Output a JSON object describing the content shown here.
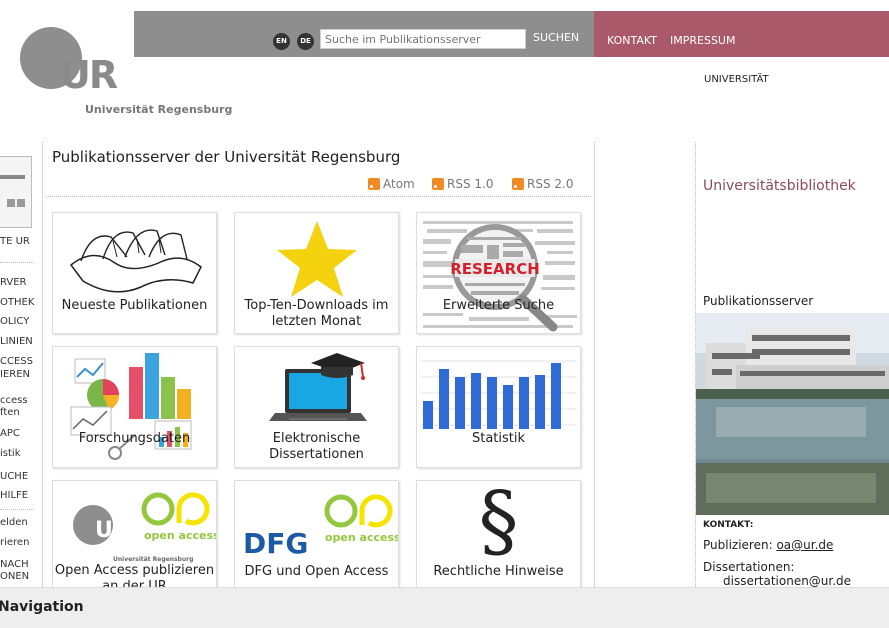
{
  "header": {
    "logo_letters": "UR",
    "logo_text": "Universität Regensburg",
    "lang_en": "EN",
    "lang_de": "DE",
    "search_placeholder": "Suche im Publikationsserver",
    "search_button": "SUCHEN",
    "kontakt": "KONTAKT",
    "impressum": "IMPRESSUM",
    "universitaet": "UNIVERSITÄT",
    "colors": {
      "gray_bar": "#8e8e8e",
      "red_bar": "#a9596a",
      "accent_title": "#8c4b5b"
    }
  },
  "sidebar": {
    "items": [
      "TE UR",
      "RVER",
      "OTHEK",
      "OLICY",
      "LINIEN",
      "CCESS",
      "IEREN",
      "ccess",
      "ften",
      "APC",
      "istik",
      "UCHE",
      "HILFE",
      "elden",
      "rieren",
      "NACH",
      "ONEN"
    ]
  },
  "main": {
    "title": "Publikationsserver der Universität Regensburg",
    "feeds": [
      "Atom",
      "RSS 1.0",
      "RSS 2.0"
    ],
    "tiles": [
      {
        "label": "Neueste Publikationen",
        "icon": "papers-icon"
      },
      {
        "label": "Top-Ten-Downloads im letzten Monat",
        "icon": "star-icon"
      },
      {
        "label": "Erweiterte Suche",
        "icon": "research-magnifier-icon",
        "badge": "RESEARCH"
      },
      {
        "label": "Forschungsdaten",
        "icon": "data-charts-icon"
      },
      {
        "label": "Elektronische Dissertationen",
        "icon": "laptop-graduation-icon"
      },
      {
        "label": "Statistik",
        "icon": "bar-chart-icon"
      },
      {
        "label": "Open Access publizieren an der UR",
        "icon": "ur-open-access-icon",
        "oa_text": "open access",
        "oa_logo": "UR",
        "oa_logo_sub": "Universität Regensburg"
      },
      {
        "label": "DFG und Open Access",
        "icon": "dfg-open-access-icon",
        "oa_text": "open access",
        "dfg": "DFG"
      },
      {
        "label": "Rechtliche Hinweise",
        "icon": "paragraph-icon",
        "symbol": "§"
      }
    ]
  },
  "right": {
    "title": "Universitätsbibliothek",
    "subtitle": "Publikationsserver",
    "kontakt_label": "KONTAKT:",
    "publizieren_label": "Publizieren:",
    "publizieren_email": "oa@ur.de",
    "dissertationen_label": "Dissertationen:",
    "dissertationen_email": "dissertationen@ur.de"
  },
  "navbar": {
    "label": "Navigation"
  }
}
